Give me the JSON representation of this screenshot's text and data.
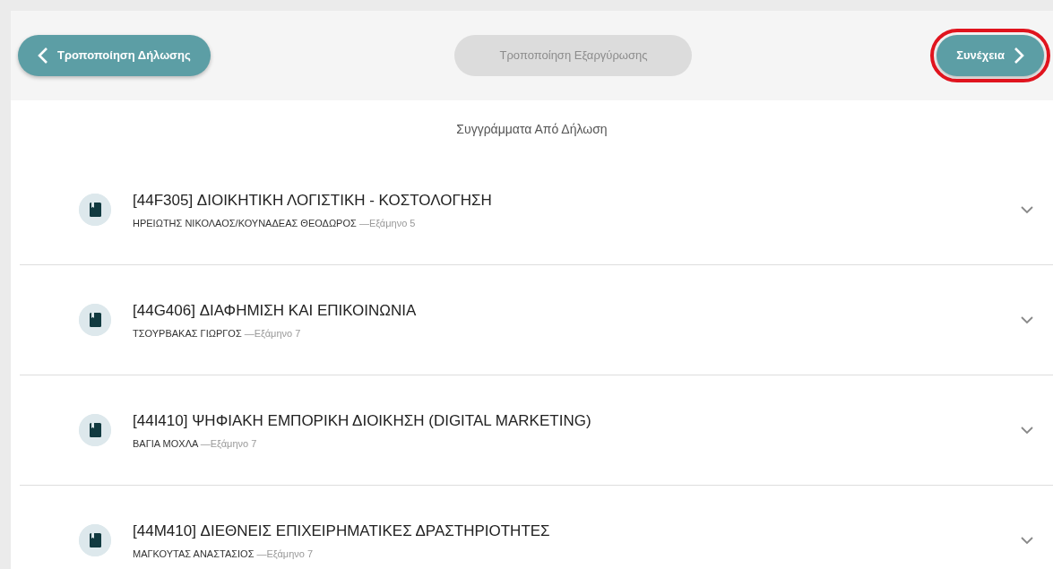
{
  "toolbar": {
    "buttons": [
      {
        "label": "Τροποποίηση Δήλωσης",
        "kind": "back",
        "disabled": false,
        "highlighted": false
      },
      {
        "label": "Τροποποίηση Εξαργύρωσης",
        "kind": "plain",
        "disabled": true,
        "highlighted": false
      },
      {
        "label": "Συνέχεια",
        "kind": "next",
        "disabled": false,
        "highlighted": true
      }
    ]
  },
  "section_title": "Συγγράμματα Από Δήλωση",
  "courses": [
    {
      "title": "[44F305] ΔΙΟΙΚΗΤΙΚΗ ΛΟΓΙΣΤΙΚΗ - ΚΟΣΤΟΛΟΓΗΣΗ",
      "instructors": "ΗΡΕΙΩΤΗΣ ΝΙΚΟΛΑΟΣ/ΚΟΥΝΑΔΕΑΣ ΘΕΟΔΩΡΟΣ",
      "semester": "—Εξάμηνο 5",
      "expanded": false
    },
    {
      "title": "[44G406] ΔΙΑΦΗΜΙΣΗ ΚΑΙ ΕΠΙΚΟΙΝΩΝΙΑ",
      "instructors": "ΤΣΟΥΡΒΑΚΑΣ ΓΙΩΡΓΟΣ",
      "semester": "—Εξάμηνο 7",
      "expanded": false
    },
    {
      "title": "[44I410] ΨΗΦΙΑΚΗ ΕΜΠΟΡΙΚΗ ΔΙΟΙΚΗΣΗ (DIGITAL MARKETING)",
      "instructors": "ΒΑΓΙΑ ΜΟΧΛΑ",
      "semester": "—Εξάμηνο 7",
      "expanded": false
    },
    {
      "title": "[44M410] ΔΙΕΘΝΕΙΣ ΕΠΙΧΕΙΡΗΜΑΤΙΚΕΣ ΔΡΑΣΤΗΡΙΟΤΗΤΕΣ",
      "instructors": "ΜΑΓΚΟΥΤΑΣ ΑΝΑΣΤΑΣΙΟΣ",
      "semester": "—Εξάμηνο 7",
      "expanded": false
    }
  ]
}
